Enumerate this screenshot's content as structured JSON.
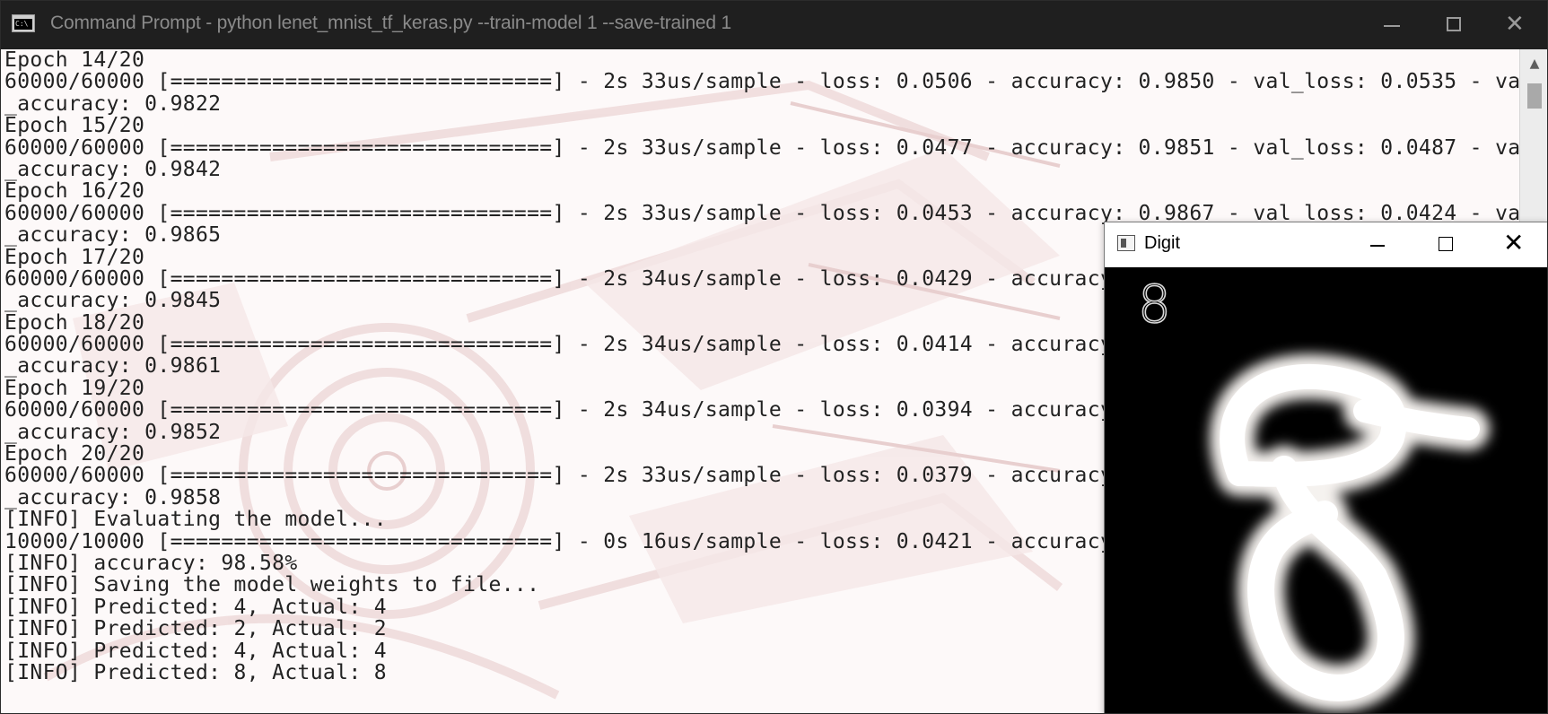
{
  "cmd_window": {
    "title": "Command Prompt - python  lenet_mnist_tf_keras.py --train-model 1 --save-trained 1",
    "icon": "console-app-icon",
    "icon_text": "C:\\"
  },
  "console": {
    "lines": [
      "Epoch 14/20",
      "60000/60000 [==============================] - 2s 33us/sample - loss: 0.0506 - accuracy: 0.9850 - val_loss: 0.0535 - val",
      "_accuracy: 0.9822",
      "Epoch 15/20",
      "60000/60000 [==============================] - 2s 33us/sample - loss: 0.0477 - accuracy: 0.9851 - val_loss: 0.0487 - val",
      "_accuracy: 0.9842",
      "Epoch 16/20",
      "60000/60000 [==============================] - 2s 33us/sample - loss: 0.0453 - accuracy: 0.9867 - val_loss: 0.0424 - val",
      "_accuracy: 0.9865",
      "Epoch 17/20",
      "60000/60000 [==============================] - 2s 34us/sample - loss: 0.0429 - accuracy",
      "_accuracy: 0.9845",
      "Epoch 18/20",
      "60000/60000 [==============================] - 2s 34us/sample - loss: 0.0414 - accuracy",
      "_accuracy: 0.9861",
      "Epoch 19/20",
      "60000/60000 [==============================] - 2s 34us/sample - loss: 0.0394 - accuracy",
      "_accuracy: 0.9852",
      "Epoch 20/20",
      "60000/60000 [==============================] - 2s 33us/sample - loss: 0.0379 - accuracy",
      "_accuracy: 0.9858",
      "[INFO] Evaluating the model...",
      "10000/10000 [==============================] - 0s 16us/sample - loss: 0.0421 - accuracy",
      "[INFO] accuracy: 98.58%",
      "[INFO] Saving the model weights to file...",
      "[INFO] Predicted: 4, Actual: 4",
      "[INFO] Predicted: 2, Actual: 2",
      "[INFO] Predicted: 4, Actual: 4",
      "[INFO] Predicted: 8, Actual: 8"
    ]
  },
  "digit_window": {
    "title": "Digit",
    "icon": "image-window-icon",
    "predicted_label": "8"
  },
  "colors": {
    "titlebar_bg": "#1f1f1f",
    "console_text": "#222222",
    "console_bg": "#fdf9f9",
    "digit_canvas_bg": "#000000",
    "digit_stroke": "#f5f2ef"
  }
}
